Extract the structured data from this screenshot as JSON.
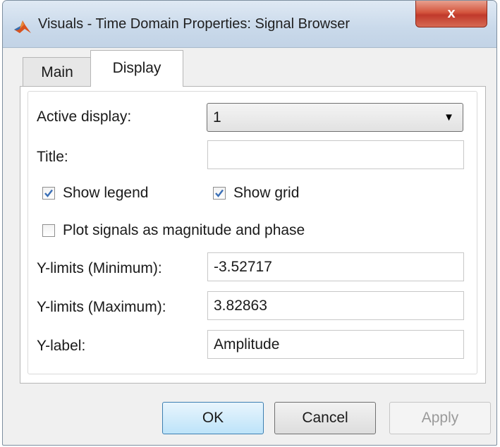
{
  "window": {
    "title": "Visuals - Time Domain Properties: Signal Browser",
    "close_label": "x"
  },
  "tabs": [
    {
      "label": "Main",
      "selected": false
    },
    {
      "label": "Display",
      "selected": true
    }
  ],
  "form": {
    "active_display": {
      "label": "Active display:",
      "value": "1"
    },
    "title": {
      "label": "Title:",
      "value": ""
    },
    "show_legend": {
      "label": "Show legend",
      "checked": true
    },
    "show_grid": {
      "label": "Show grid",
      "checked": true
    },
    "magnitude_phase": {
      "label": "Plot signals as magnitude and phase",
      "checked": false
    },
    "ymin": {
      "label": "Y-limits (Minimum):",
      "value": "-3.52717"
    },
    "ymax": {
      "label": "Y-limits (Maximum):",
      "value": "3.82863"
    },
    "ylabel": {
      "label": "Y-label:",
      "value": "Amplitude"
    }
  },
  "buttons": {
    "ok": "OK",
    "cancel": "Cancel",
    "apply": "Apply"
  },
  "colors": {
    "accent": "#3c7fb1",
    "close": "#c0392b",
    "check": "#3b6fb6"
  }
}
